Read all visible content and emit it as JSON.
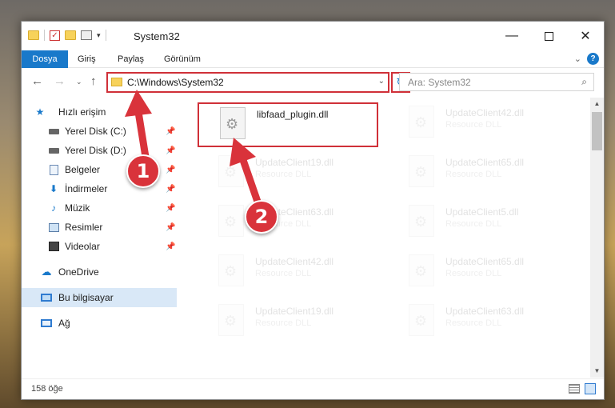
{
  "window": {
    "title": "System32"
  },
  "window_controls": {
    "minimize": "—",
    "close": "✕"
  },
  "ribbon": {
    "tabs": [
      {
        "label": "Dosya",
        "active": true
      },
      {
        "label": "Giriş",
        "active": false
      },
      {
        "label": "Paylaş",
        "active": false
      },
      {
        "label": "Görünüm",
        "active": false
      }
    ],
    "help": "?"
  },
  "nav": {
    "back": "←",
    "forward": "→",
    "recent": "⌄",
    "up": "↑"
  },
  "address": {
    "path": "C:\\Windows\\System32",
    "refresh": "↻"
  },
  "search": {
    "placeholder": "Ara: System32"
  },
  "sidebar": {
    "items": [
      {
        "label": "Hızlı erişim",
        "icon": "star-icon"
      },
      {
        "label": "Yerel Disk (C:)",
        "icon": "drive-icon",
        "pinned": true
      },
      {
        "label": "Yerel Disk (D:)",
        "icon": "drive-icon",
        "pinned": true
      },
      {
        "label": "Belgeler",
        "icon": "documents-icon",
        "pinned": true
      },
      {
        "label": "İndirmeler",
        "icon": "downloads-icon",
        "pinned": true
      },
      {
        "label": "Müzik",
        "icon": "music-icon",
        "pinned": true
      },
      {
        "label": "Resimler",
        "icon": "pictures-icon",
        "pinned": true
      },
      {
        "label": "Videolar",
        "icon": "videos-icon",
        "pinned": true
      },
      {
        "label": "OneDrive",
        "icon": "cloud-icon"
      },
      {
        "label": "Bu bilgisayar",
        "icon": "computer-icon",
        "selected": true
      },
      {
        "label": "Ağ",
        "icon": "network-icon"
      }
    ]
  },
  "files": [
    {
      "name": "libfaad_plugin.dll",
      "type": ""
    },
    {
      "name": "UpdateClient42.dll",
      "type": "Resource DLL"
    },
    {
      "name": "UpdateClient19.dll",
      "type": "Resource DLL"
    },
    {
      "name": "UpdateClient65.dll",
      "type": "Resource DLL"
    },
    {
      "name": "UpdateClient63.dll",
      "type": "Resource DLL"
    },
    {
      "name": "UpdateClient5.dll",
      "type": "Resource DLL"
    },
    {
      "name": "UpdateClient42.dll",
      "type": "Resource DLL"
    },
    {
      "name": "UpdateClient65.dll",
      "type": "Resource DLL"
    },
    {
      "name": "UpdateClient19.dll",
      "type": "Resource DLL"
    },
    {
      "name": "UpdateClient63.dll",
      "type": "Resource DLL"
    }
  ],
  "status": {
    "count": "158 öğe"
  },
  "annotations": {
    "step1": "1",
    "step2": "2",
    "color": "#d9333b"
  }
}
